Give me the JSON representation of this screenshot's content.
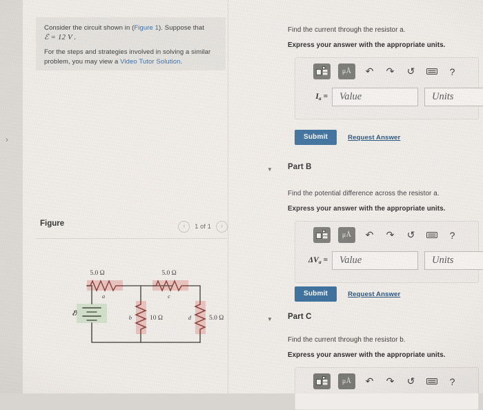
{
  "window": {
    "collapse_handle": "›"
  },
  "problem": {
    "line1_pre": "Consider the circuit shown in (",
    "figure_link": "Figure 1",
    "line1_post": "). Suppose that",
    "emf_symbol": "ℰ",
    "emf_value": "= 12  V .",
    "line2_pre": "For the steps and strategies involved in solving a similar problem, you may view a ",
    "tutor_link": "Video Tutor Solution",
    "line2_post": "."
  },
  "figure": {
    "title": "Figure",
    "prev_arrow": "‹",
    "next_arrow": "›",
    "pager_label": "1 of 1",
    "circuit": {
      "source_label": "ℰ",
      "resistors": [
        {
          "id": "a",
          "label": "a",
          "value": "5.0 Ω",
          "orientation": "horizontal"
        },
        {
          "id": "c",
          "label": "c",
          "value": "5.0 Ω",
          "orientation": "horizontal"
        },
        {
          "id": "b",
          "label": "b",
          "value": "10 Ω",
          "orientation": "vertical"
        },
        {
          "id": "d",
          "label": "d",
          "value": "5.0 Ω",
          "orientation": "vertical"
        }
      ]
    }
  },
  "toolbar": {
    "template_icon": "template-icon",
    "units_icon_text": "μÅ",
    "undo": "↶",
    "redo": "↷",
    "reset": "↺",
    "keyboard": "keyboard-icon",
    "help": "?"
  },
  "common": {
    "express_units": "Express your answer with the appropriate units.",
    "value_placeholder": "Value",
    "units_placeholder": "Units",
    "submit_label": "Submit",
    "request_answer_label": "Request Answer",
    "caret": "▼"
  },
  "parts": [
    {
      "key": "part_a",
      "title": "",
      "question": "Find the current through the resistor a.",
      "label_main": "I",
      "label_sub": "a",
      "label_eq": " ="
    },
    {
      "key": "part_b",
      "title": "Part B",
      "question": "Find the potential difference across the resistor a.",
      "label_main": "ΔV",
      "label_sub": "a",
      "label_eq": " ="
    },
    {
      "key": "part_c",
      "title": "Part C",
      "question": "Find the current through the resistor b.",
      "label_main": "",
      "label_sub": "",
      "label_eq": ""
    }
  ],
  "colors": {
    "page_bg": "#f2efeb",
    "panel_bg": "#e6e4e0",
    "link": "#2f6fb5",
    "submit_bg": "#3a6f9e",
    "request_link": "#25537f",
    "toolbar_btn": "#7b7b78",
    "resistor_highlight": "#e8b9b3",
    "battery_highlight": "#cfe0c8"
  }
}
